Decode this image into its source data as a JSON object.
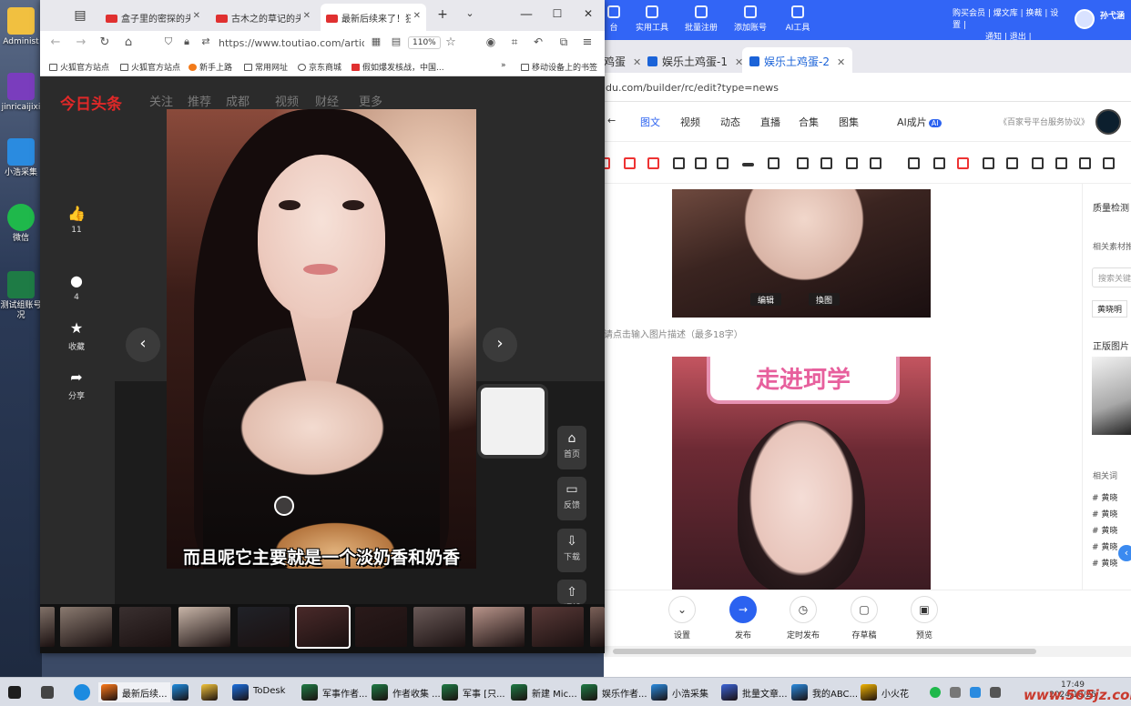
{
  "desktop": {
    "icons": [
      {
        "label": "Administ",
        "color": "#f1c040"
      },
      {
        "label": "jinricaijixi",
        "color": "#7a3dbd"
      },
      {
        "label": "小浩采集",
        "color": "#2a8be0"
      },
      {
        "label": "微信",
        "color": "#1fb84b"
      },
      {
        "label": "测试组账号况",
        "color": "#1e7b45"
      }
    ]
  },
  "back_browser": {
    "topbar": {
      "tools": [
        "台",
        "实用工具",
        "批量注册",
        "添加账号",
        "AI工具"
      ],
      "userlinks_line1": "购买会员 | 爆文库 | 换裁 | 设置 |",
      "userlinks_line2": "通知 | 退出 |",
      "username": "孙弋涵"
    },
    "tabs": [
      {
        "label": "鸡蛋"
      },
      {
        "label": "娱乐土鸡蛋-1"
      },
      {
        "label": "娱乐土鸡蛋-2"
      }
    ],
    "url": "du.com/builder/rc/edit?type=news",
    "editor_tabs": [
      "图文",
      "视频",
      "动态",
      "直播",
      "合集",
      "图集",
      "AI成片"
    ],
    "ai_badge": "AI",
    "protocol": "《百家号平台服务协议》",
    "image_buttons": {
      "edit": "编辑",
      "replace": "換图"
    },
    "caption_placeholder": "请点击输入图片描述（最多18字）",
    "banner_text": "走进珂学",
    "side": {
      "title": "质量检测",
      "related": "相关素材推",
      "search_placeholder": "搜索关键",
      "tag": "黄晓明",
      "copyright_title": "正版图片",
      "related_words": "相关词",
      "hashtags": [
        "# 黄晓",
        "# 黄晓",
        "# 黄晓",
        "# 黄晓",
        "# 黄晓"
      ]
    },
    "actions": [
      {
        "label": "设置",
        "icon": "⌄"
      },
      {
        "label": "发布",
        "icon": "→"
      },
      {
        "label": "定时发布",
        "icon": "◷"
      },
      {
        "label": "存草稿",
        "icon": "▢"
      },
      {
        "label": "预览",
        "icon": "▣"
      }
    ]
  },
  "front_browser": {
    "tabs": [
      {
        "label": "盒子里的密探的头条"
      },
      {
        "label": "古木之的草记的头条"
      },
      {
        "label": "最新后续来了！狂欢"
      }
    ],
    "url": "https://www.toutiao.com/article/",
    "zoom": "110%",
    "bookmarks": [
      "火狐官方站点",
      "火狐官方站点",
      "新手上路",
      "常用网址",
      "京东商城",
      "假如爆发核战，中国...",
      "移动设备上的书签"
    ],
    "site": {
      "logo": "今日头条",
      "nav": [
        "关注",
        "推荐",
        "成都",
        "视频",
        "财经",
        "更多"
      ]
    },
    "side_actions": [
      {
        "icon": "👍",
        "label": "11"
      },
      {
        "icon": "●",
        "label": "4"
      },
      {
        "icon": "★",
        "label": "收藏"
      },
      {
        "icon": "➦",
        "label": "分享"
      }
    ],
    "subtitle": "而且呢它主要就是一个淡奶香和奶香",
    "right_buttons": [
      {
        "icon": "⌂",
        "label": "首页"
      },
      {
        "icon": "▭",
        "label": "反馈"
      },
      {
        "icon": "⇩",
        "label": "下载"
      },
      {
        "icon": "⇧",
        "label": "顶部"
      }
    ],
    "thumbnails": [
      "#8a7a70",
      "#3a3030",
      "#c8b5a8",
      "#202228",
      "#4a2a2a",
      "#2a1a1a",
      "#6a5a58",
      "#b8948a",
      "#5a3a38",
      "#7a6058"
    ]
  },
  "taskbar": {
    "items": [
      {
        "label": "最新后续...",
        "color": "#ff7a1a"
      },
      {
        "label": "",
        "color": "#1c8be0"
      },
      {
        "label": "",
        "color": "#f2c33a"
      },
      {
        "label": "ToDesk",
        "color": "#1a6fe0"
      },
      {
        "label": "军事作者...",
        "color": "#1e7b45"
      },
      {
        "label": "作者收集 ...",
        "color": "#1e7b45"
      },
      {
        "label": "军事 [只...",
        "color": "#1e7b45"
      },
      {
        "label": "新建 Mic...",
        "color": "#1e7b45"
      },
      {
        "label": "娱乐作者...",
        "color": "#1e7b45"
      },
      {
        "label": "小浩采集",
        "color": "#2a8be0"
      },
      {
        "label": "批量文章...",
        "color": "#3b64d8"
      },
      {
        "label": "我的ABC...",
        "color": "#2a8be0"
      },
      {
        "label": "小火花",
        "color": "#f2b400"
      }
    ],
    "time": "17:49",
    "date": "2024/10/25",
    "watermark": "www.565jz.com"
  }
}
